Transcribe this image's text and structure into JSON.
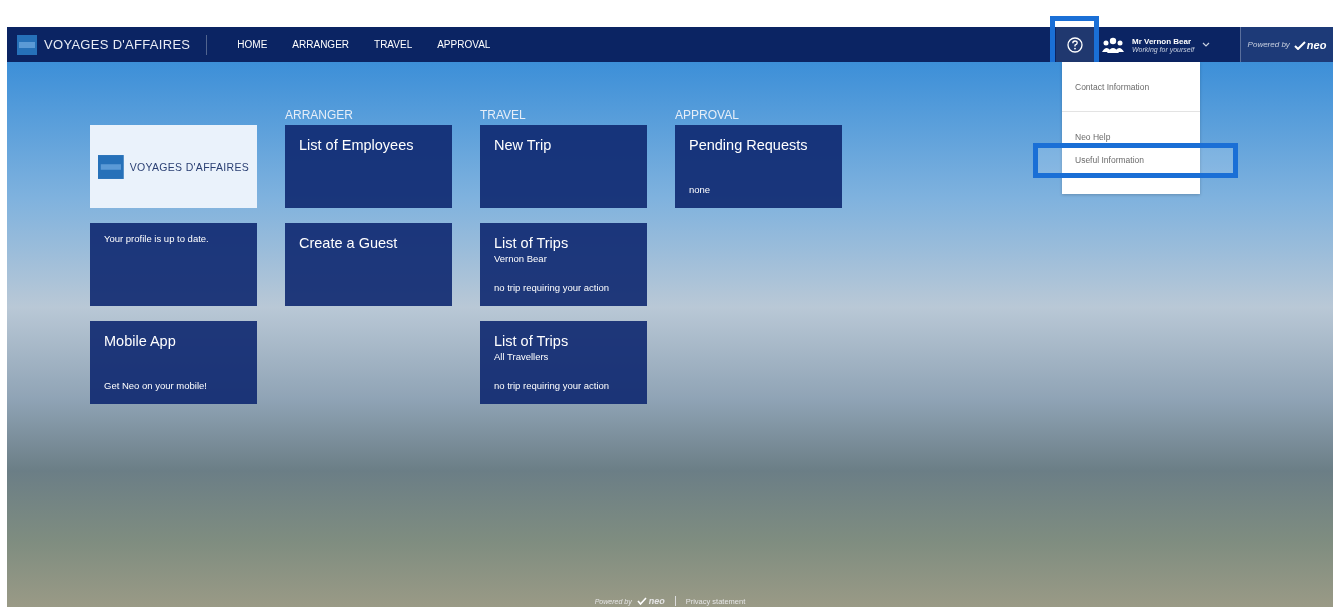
{
  "navbar": {
    "brand": "VOYAGES D'AFFAIRES",
    "links": [
      {
        "label": "HOME"
      },
      {
        "label": "ARRANGER"
      },
      {
        "label": "TRAVEL"
      },
      {
        "label": "APPROVAL"
      }
    ],
    "help_button": {
      "highlighted": true
    },
    "user": {
      "name": "Mr Vernon Bear",
      "subtitle": "Working for yourself"
    },
    "powered_by": {
      "prefix": "Powered by",
      "brand": "neo"
    }
  },
  "help_menu": {
    "open": true,
    "items": [
      {
        "label": "Contact Information",
        "highlighted": false,
        "divider_after": true
      },
      {
        "label": "Neo Help",
        "highlighted": false,
        "divider_after": false
      },
      {
        "label": "Useful Information",
        "highlighted": true,
        "divider_after": false
      }
    ]
  },
  "dashboard": {
    "columns": [
      {
        "tiles": [
          {
            "kind": "logo",
            "brand": "VOYAGES D'AFFAIRES"
          },
          {
            "kind": "tile",
            "detail": "Your profile is up to date."
          },
          {
            "kind": "tile",
            "title": "Mobile App",
            "detail": "Get Neo on your mobile!"
          }
        ]
      },
      {
        "header": "ARRANGER",
        "tiles": [
          {
            "kind": "tile",
            "title": "List of Employees"
          },
          {
            "kind": "tile",
            "title": "Create a Guest"
          }
        ]
      },
      {
        "header": "TRAVEL",
        "tiles": [
          {
            "kind": "tile",
            "title": "New Trip"
          },
          {
            "kind": "tile",
            "title": "List of Trips",
            "subtitle": "Vernon Bear",
            "detail": "no trip requiring your action"
          },
          {
            "kind": "tile",
            "title": "List of Trips",
            "subtitle": "All Travellers",
            "detail": "no trip requiring your action"
          }
        ]
      },
      {
        "header": "APPROVAL",
        "tiles": [
          {
            "kind": "tile",
            "title": "Pending Requests",
            "detail": "none"
          }
        ]
      }
    ]
  },
  "footer": {
    "prefix": "Powered by",
    "brand": "neo",
    "link": "Privacy statement"
  }
}
